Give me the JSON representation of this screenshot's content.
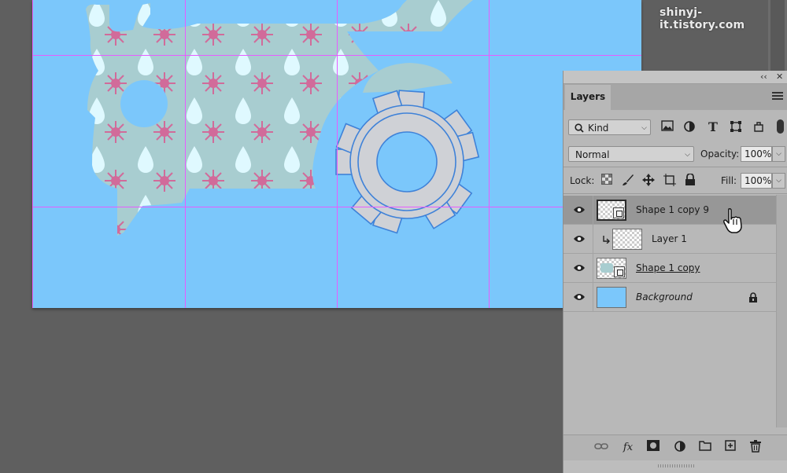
{
  "watermark": "shinyj-it.tistory.com",
  "canvas": {
    "background": "#7bc7fb",
    "shape_fill": "#a8cdd0",
    "star_color": "#d16b9a",
    "drop_color": "#dff9ff",
    "gear_fill": "#cfd1d6",
    "gear_stroke": "#3f82d8",
    "guide_color": "#e75cff"
  },
  "panel": {
    "collapse_label": "‹‹",
    "close_label": "✕",
    "tab": "Layers",
    "filter": {
      "kind_label": "Kind",
      "icons": [
        "image-filter-icon",
        "adjustment-filter-icon",
        "type-filter-icon",
        "shape-filter-icon",
        "smart-object-filter-icon"
      ],
      "type_glyph": "T"
    },
    "blend_mode": "Normal",
    "opacity_label": "Opacity:",
    "opacity_value": "100%",
    "lock_label": "Lock:",
    "fill_label": "Fill:",
    "fill_value": "100%",
    "layers": [
      {
        "name": "Shape 1 copy 9",
        "selected": true,
        "italic": false,
        "underline": false
      },
      {
        "name": "Layer 1",
        "selected": false,
        "clipped": true,
        "italic": false,
        "underline": false
      },
      {
        "name": "Shape 1 copy",
        "selected": false,
        "italic": false,
        "underline": true
      },
      {
        "name": "Background",
        "selected": false,
        "italic": true,
        "locked": true
      }
    ],
    "footer_fx": "fx"
  }
}
